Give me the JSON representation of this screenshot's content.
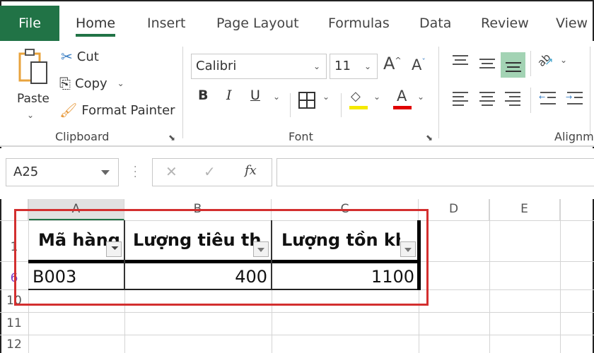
{
  "tabs": [
    {
      "label": "File"
    },
    {
      "label": "Home",
      "active": true
    },
    {
      "label": "Insert"
    },
    {
      "label": "Page Layout"
    },
    {
      "label": "Formulas"
    },
    {
      "label": "Data"
    },
    {
      "label": "Review"
    },
    {
      "label": "View"
    }
  ],
  "ribbon": {
    "clipboard": {
      "label": "Clipboard",
      "paste": "Paste",
      "cut": "Cut",
      "copy": "Copy",
      "format_painter": "Format Painter"
    },
    "font": {
      "label": "Font",
      "font_name": "Calibri",
      "font_size": "11",
      "bold": "B",
      "italic": "I",
      "underline": "U",
      "highlight_color": "#f5e900",
      "font_color": "#e00000"
    },
    "alignment": {
      "label": "Alignm"
    }
  },
  "formula_bar": {
    "name_box": "A25",
    "cancel": "✕",
    "enter": "✓",
    "fx": "fx",
    "value": ""
  },
  "sheet": {
    "columns": [
      "A",
      "B",
      "C",
      "D",
      "E"
    ],
    "rows": [
      "1",
      "6",
      "10",
      "11",
      "12"
    ],
    "headers": [
      "Mã hàng",
      "Lượng tiêu thụ",
      "Lượng tồn kho"
    ],
    "data_row": [
      "B003",
      "400",
      "1100"
    ],
    "highlight_color": "#d32f2f",
    "accent_color": "#217346"
  }
}
